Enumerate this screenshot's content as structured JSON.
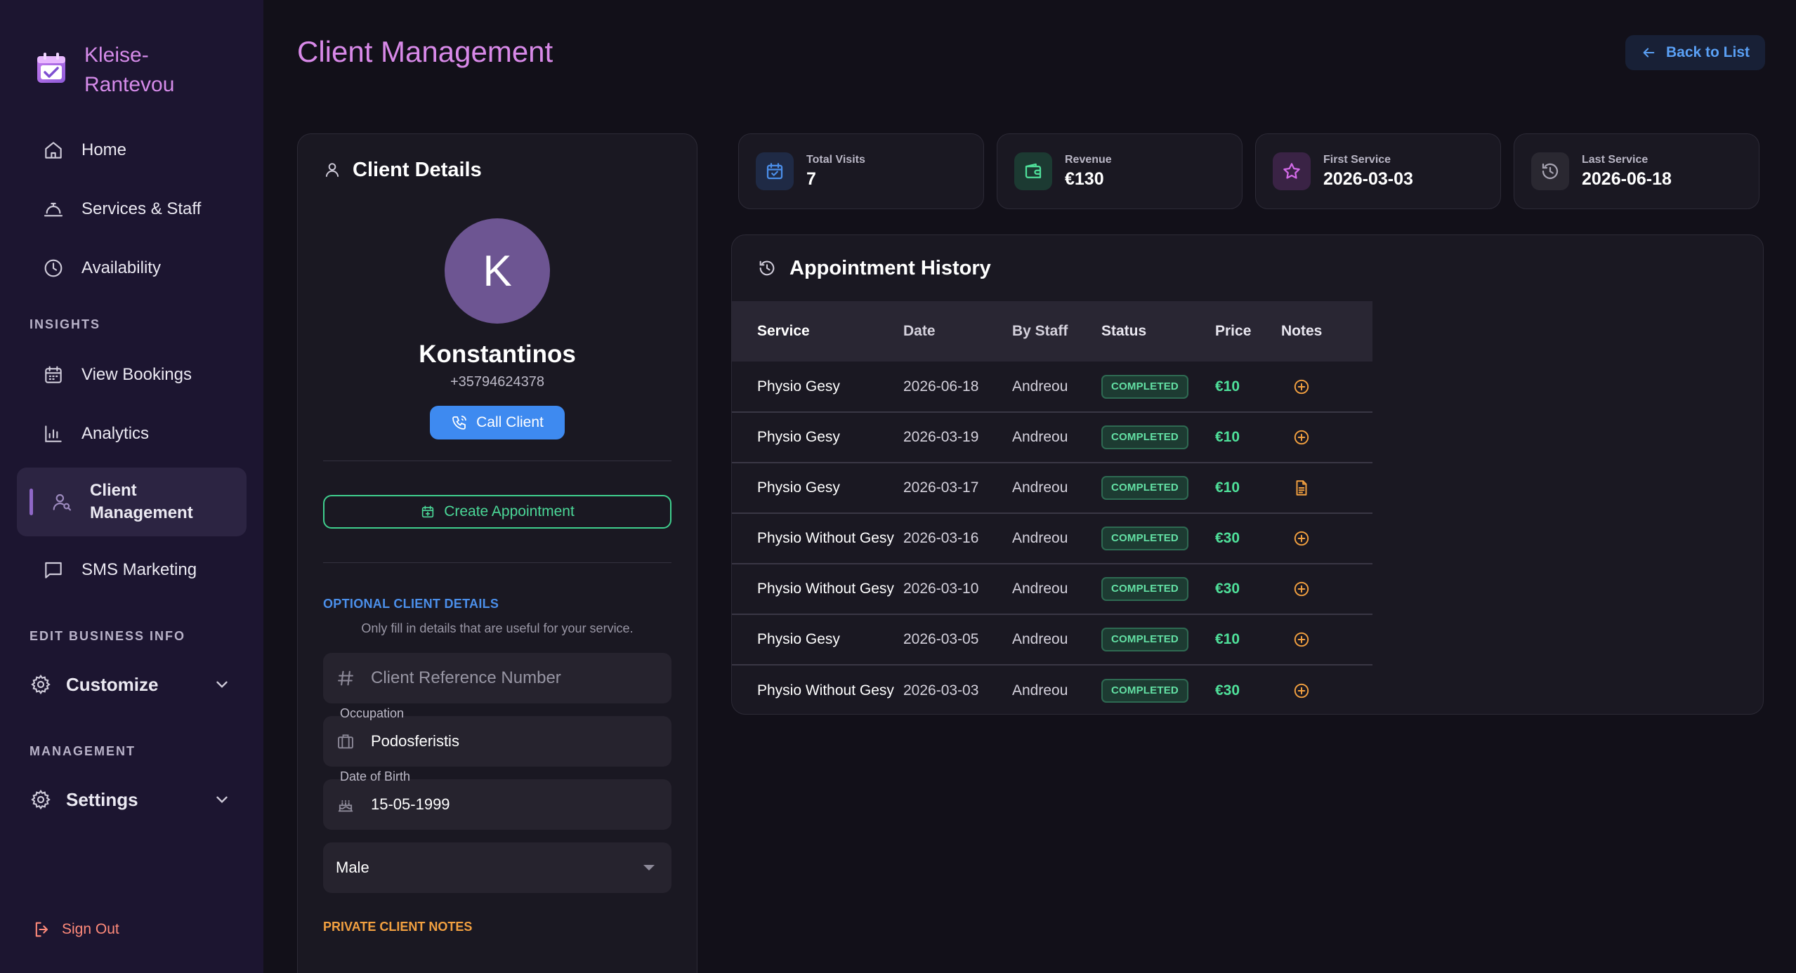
{
  "brand": {
    "line1": "Kleise-",
    "line2": "Rantevou"
  },
  "nav": {
    "home": "Home",
    "services": "Services & Staff",
    "availability": "Availability",
    "insights_label": "INSIGHTS",
    "bookings": "View Bookings",
    "analytics": "Analytics",
    "client_mgmt_1": "Client",
    "client_mgmt_2": "Management",
    "sms": "SMS Marketing",
    "edit_label": "EDIT BUSINESS INFO",
    "customize": "Customize",
    "management_label": "MANAGEMENT",
    "settings": "Settings",
    "signout": "Sign Out"
  },
  "page": {
    "title": "Client Management",
    "back": "Back to List"
  },
  "client": {
    "card_title": "Client Details",
    "initial": "K",
    "name": "Konstantinos",
    "phone": "+35794624378",
    "call": "Call Client",
    "create": "Create Appointment",
    "optional_label": "OPTIONAL CLIENT DETAILS",
    "optional_help": "Only fill in details that are useful for your service.",
    "ref_placeholder": "Client Reference Number",
    "occupation_label": "Occupation",
    "occupation": "Podosferistis",
    "dob_label": "Date of Birth",
    "dob": "15-05-1999",
    "gender": "Male",
    "notes_label": "PRIVATE CLIENT NOTES"
  },
  "stats": [
    {
      "label": "Total Visits",
      "value": "7"
    },
    {
      "label": "Revenue",
      "value": "€130"
    },
    {
      "label": "First Service",
      "value": "2026-03-03"
    },
    {
      "label": "Last Service",
      "value": "2026-06-18"
    }
  ],
  "history": {
    "title": "Appointment History",
    "columns": [
      "Service",
      "Date",
      "By Staff",
      "Status",
      "Price",
      "Notes"
    ],
    "rows": [
      {
        "service": "Physio Gesy",
        "date": "2026-06-18",
        "staff": "Andreou",
        "status": "COMPLETED",
        "price": "€10",
        "note": "add"
      },
      {
        "service": "Physio Gesy",
        "date": "2026-03-19",
        "staff": "Andreou",
        "status": "COMPLETED",
        "price": "€10",
        "note": "add"
      },
      {
        "service": "Physio Gesy",
        "date": "2026-03-17",
        "staff": "Andreou",
        "status": "COMPLETED",
        "price": "€10",
        "note": "doc"
      },
      {
        "service": "Physio Without Gesy",
        "date": "2026-03-16",
        "staff": "Andreou",
        "status": "COMPLETED",
        "price": "€30",
        "note": "add"
      },
      {
        "service": "Physio Without Gesy",
        "date": "2026-03-10",
        "staff": "Andreou",
        "status": "COMPLETED",
        "price": "€30",
        "note": "add"
      },
      {
        "service": "Physio Gesy",
        "date": "2026-03-05",
        "staff": "Andreou",
        "status": "COMPLETED",
        "price": "€10",
        "note": "add"
      },
      {
        "service": "Physio Without Gesy",
        "date": "2026-03-03",
        "staff": "Andreou",
        "status": "COMPLETED",
        "price": "€30",
        "note": "add"
      }
    ]
  },
  "colors": {
    "accent": "#d889e8",
    "primary": "#3e8af0",
    "success": "#4fe09a",
    "warning": "#f2a040"
  }
}
